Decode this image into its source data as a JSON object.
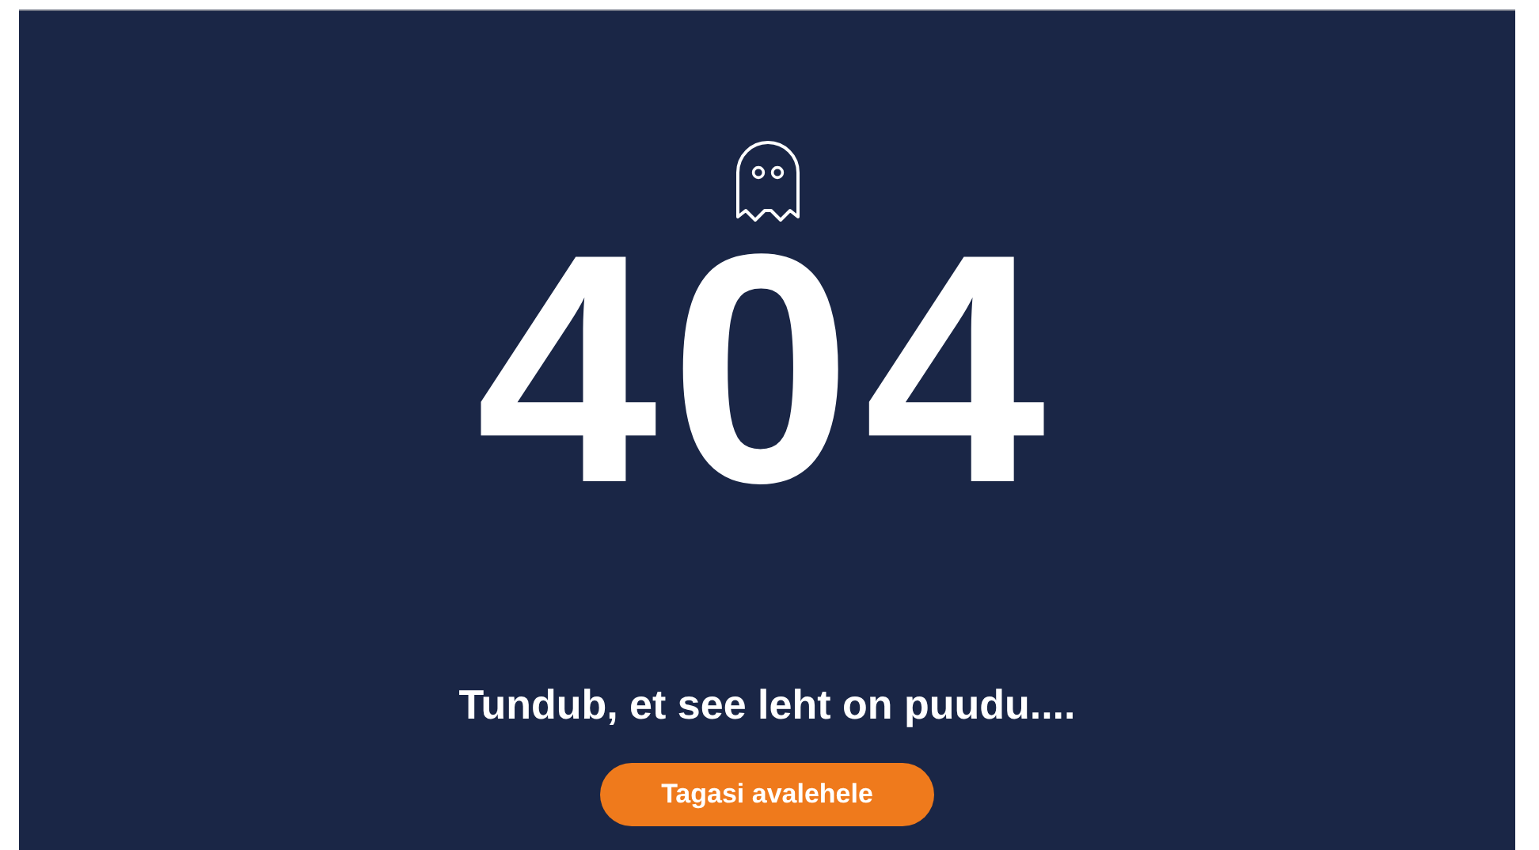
{
  "error_code": "404",
  "message": "Tundub, et see leht on puudu....",
  "button": {
    "label": "Tagasi avalehele"
  }
}
